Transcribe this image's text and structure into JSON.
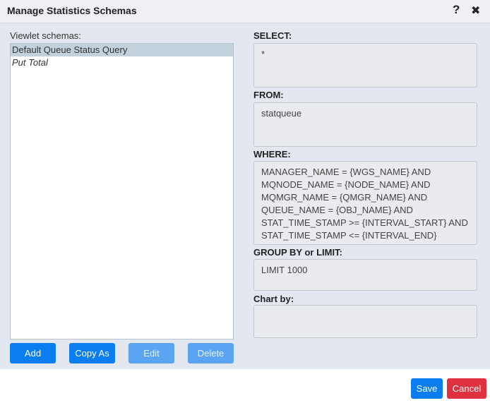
{
  "dialog": {
    "title": "Manage Statistics Schemas",
    "help_glyph": "?",
    "close_glyph": "✖"
  },
  "schemas": {
    "label": "Viewlet schemas:",
    "items": [
      {
        "label": "Default Queue Status Query",
        "selected": true,
        "italic": false
      },
      {
        "label": "Put Total",
        "selected": false,
        "italic": true
      }
    ]
  },
  "buttons": {
    "add": "Add",
    "copy_as": "Copy As",
    "edit": "Edit",
    "delete": "Delete",
    "save": "Save",
    "cancel": "Cancel"
  },
  "query": {
    "select_label": "SELECT:",
    "select_value": "*",
    "from_label": "FROM:",
    "from_value": "statqueue",
    "where_label": "WHERE:",
    "where_value": "MANAGER_NAME = {WGS_NAME} AND MQNODE_NAME = {NODE_NAME} AND MQMGR_NAME = {QMGR_NAME} AND QUEUE_NAME = {OBJ_NAME} AND STAT_TIME_STAMP >= {INTERVAL_START} AND STAT_TIME_STAMP <= {INTERVAL_END}",
    "group_label": "GROUP BY or LIMIT:",
    "group_value": "LIMIT 1000",
    "chart_label": "Chart by:",
    "chart_value": ""
  },
  "colors": {
    "primary": "#0a7ef0",
    "disabled": "#5aa4f1",
    "danger": "#e0313e",
    "selection": "#c2d1dc"
  }
}
